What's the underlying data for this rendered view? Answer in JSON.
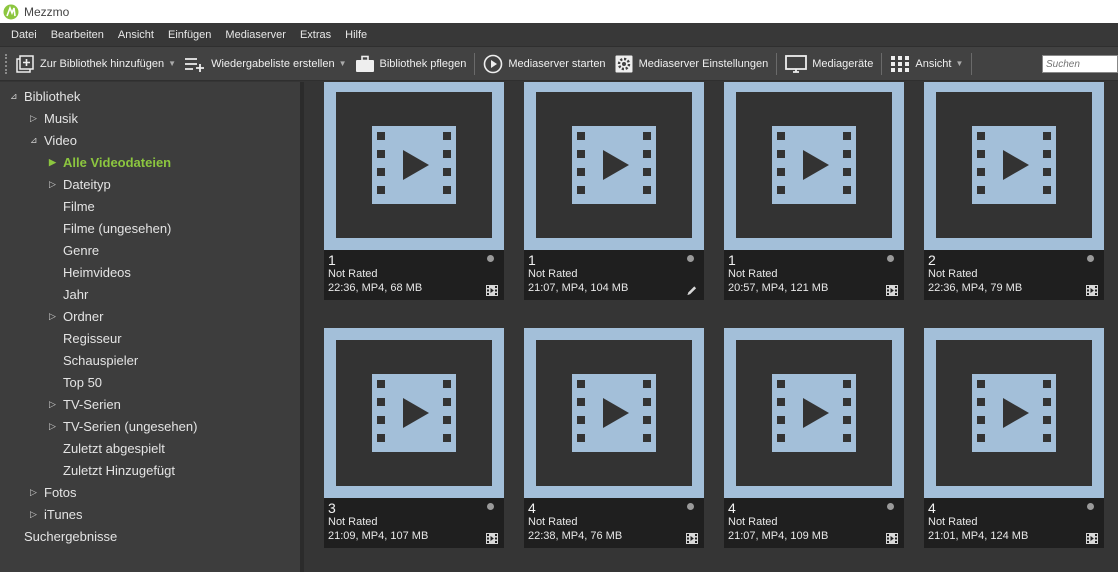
{
  "window": {
    "title": "Mezzmo"
  },
  "menu": [
    "Datei",
    "Bearbeiten",
    "Ansicht",
    "Einfügen",
    "Mediaserver",
    "Extras",
    "Hilfe"
  ],
  "toolbar": {
    "add_library": "Zur Bibliothek hinzufügen",
    "create_playlist": "Wiedergabeliste erstellen",
    "maintain_library": "Bibliothek pflegen",
    "start_server": "Mediaserver starten",
    "server_settings": "Mediaserver Einstellungen",
    "devices": "Mediageräte",
    "view": "Ansicht",
    "search_placeholder": "Suchen"
  },
  "sidebar": {
    "items": [
      {
        "label": "Bibliothek",
        "arrow": "⊿"
      },
      {
        "label": "Musik",
        "arrow": "▷"
      },
      {
        "label": "Video",
        "arrow": "⊿"
      },
      {
        "label": "Alle Videodateien",
        "arrow": "▶",
        "active": true
      },
      {
        "label": "Dateityp",
        "arrow": "▷"
      },
      {
        "label": "Filme",
        "arrow": ""
      },
      {
        "label": "Filme (ungesehen)",
        "arrow": ""
      },
      {
        "label": "Genre",
        "arrow": ""
      },
      {
        "label": "Heimvideos",
        "arrow": ""
      },
      {
        "label": "Jahr",
        "arrow": ""
      },
      {
        "label": "Ordner",
        "arrow": "▷"
      },
      {
        "label": "Regisseur",
        "arrow": ""
      },
      {
        "label": "Schauspieler",
        "arrow": ""
      },
      {
        "label": "Top 50",
        "arrow": ""
      },
      {
        "label": "TV-Serien",
        "arrow": "▷"
      },
      {
        "label": "TV-Serien (ungesehen)",
        "arrow": "▷"
      },
      {
        "label": "Zuletzt abgespielt",
        "arrow": ""
      },
      {
        "label": "Zuletzt Hinzugefügt",
        "arrow": ""
      },
      {
        "label": "Fotos",
        "arrow": "▷"
      },
      {
        "label": "iTunes",
        "arrow": "▷"
      },
      {
        "label": "Suchergebnisse",
        "arrow": ""
      }
    ]
  },
  "videos": [
    {
      "num": "1",
      "rating": "Not Rated",
      "info": "22:36, MP4, 68 MB",
      "icon": "film-icon"
    },
    {
      "num": "1",
      "rating": "Not Rated",
      "info": "21:07, MP4, 104 MB",
      "icon": "pencil-icon"
    },
    {
      "num": "1",
      "rating": "Not Rated",
      "info": "20:57, MP4, 121 MB",
      "icon": "film-icon"
    },
    {
      "num": "2",
      "rating": "Not Rated",
      "info": "22:36, MP4, 79 MB",
      "icon": "film-icon"
    },
    {
      "num": "3",
      "rating": "Not Rated",
      "info": "21:09, MP4, 107 MB",
      "icon": "film-icon"
    },
    {
      "num": "4",
      "rating": "Not Rated",
      "info": "22:38, MP4, 76 MB",
      "icon": "film-icon"
    },
    {
      "num": "4",
      "rating": "Not Rated",
      "info": "21:07, MP4, 109 MB",
      "icon": "film-icon"
    },
    {
      "num": "4",
      "rating": "Not Rated",
      "info": "21:01, MP4, 124 MB",
      "icon": "film-icon"
    }
  ],
  "colors": {
    "accent": "#8cc63f",
    "thumb": "#a3bfd9",
    "background": "#353535"
  }
}
